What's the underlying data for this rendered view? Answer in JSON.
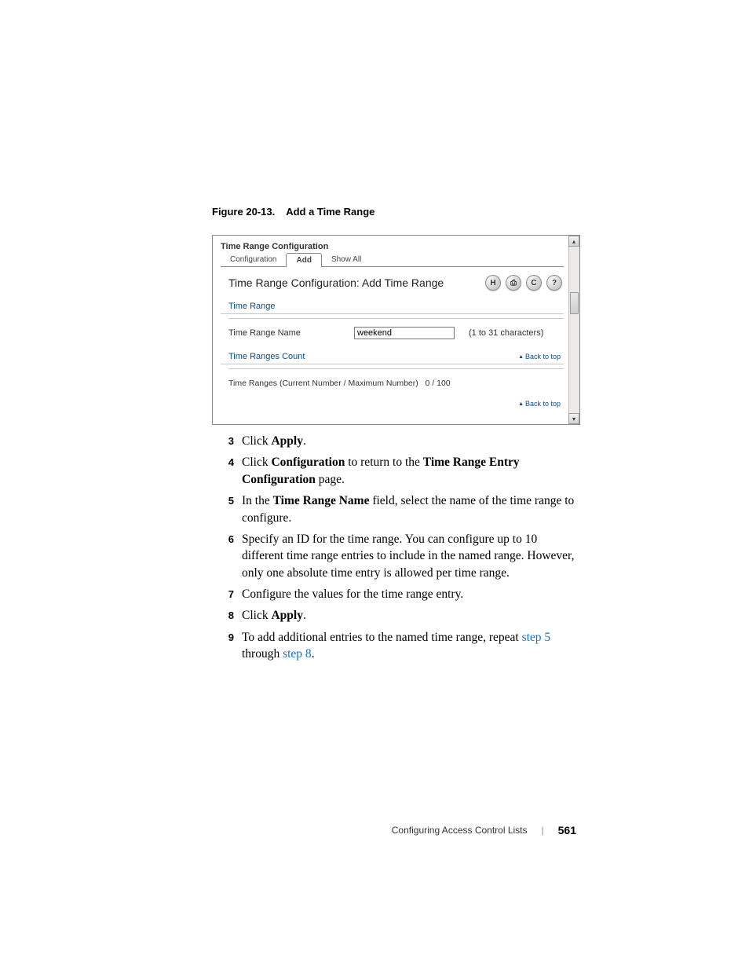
{
  "figure": {
    "label": "Figure 20-13.",
    "title": "Add a Time Range"
  },
  "webui": {
    "header": "Time Range Configuration",
    "tabs": [
      "Configuration",
      "Add",
      "Show All"
    ],
    "panel_title": "Time Range Configuration: Add Time Range",
    "icons": {
      "save": "H",
      "print": "⎙",
      "refresh": "C",
      "help": "?"
    },
    "section_time_range": "Time Range",
    "timerange_label": "Time Range Name",
    "timerange_value": "weekend",
    "timerange_hint": "(1 to 31 characters)",
    "section_count": "Time Ranges Count",
    "back_to_top": "Back to top",
    "count_label": "Time Ranges (Current Number / Maximum Number)",
    "count_value": "0 / 100"
  },
  "steps": {
    "s3": {
      "a": "Click ",
      "b": "Apply",
      "c": "."
    },
    "s4": {
      "a": "Click ",
      "b": "Configuration",
      "c": " to return to the ",
      "d": "Time Range Entry Configuration",
      "e": " page."
    },
    "s5": {
      "a": "In the ",
      "b": "Time Range Name",
      "c": " field, select the name of the time range to configure."
    },
    "s6": "Specify an ID for the time range. You can configure up to 10 different time range entries to include in the named range. However, only one absolute time entry is allowed per time range.",
    "s7": "Configure the values for the time range entry.",
    "s8": {
      "a": "Click ",
      "b": "Apply",
      "c": "."
    },
    "s9": {
      "a": "To add additional entries to the named time range, repeat ",
      "link1": "step 5",
      "b": " through ",
      "link2": "step 8",
      "c": "."
    }
  },
  "footer": {
    "chapter": "Configuring Access Control Lists",
    "page": "561"
  }
}
